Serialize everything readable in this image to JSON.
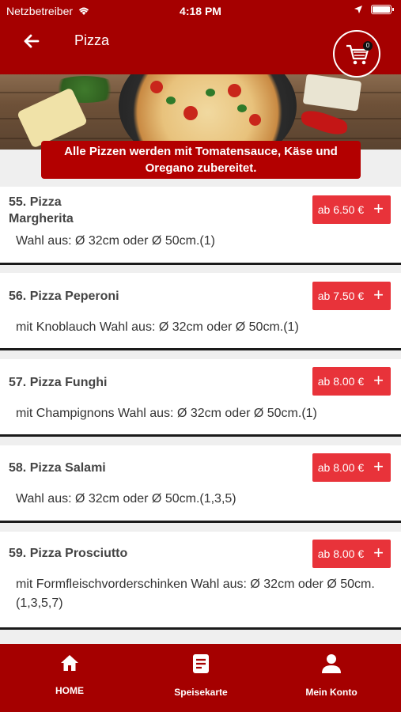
{
  "status_bar": {
    "carrier": "Netzbetreiber",
    "time": "4:18 PM"
  },
  "header": {
    "title": "Pizza",
    "cart_count": "0"
  },
  "banner": {
    "line1": "Alle Pizzen werden mit Tomatensauce, Käse und",
    "line2": "Oregano zubereitet."
  },
  "items": [
    {
      "name_line1": "55. Pizza",
      "name_line2": "Margherita",
      "price": "ab 6.50 €",
      "desc": "Wahl aus: Ø 32cm oder Ø 50cm.(1)"
    },
    {
      "name_line1": "56. Pizza Peperoni",
      "price": "ab 7.50 €",
      "desc": "mit Knoblauch Wahl aus: Ø 32cm oder Ø 50cm.(1)"
    },
    {
      "name_line1": "57. Pizza Funghi",
      "price": "ab 8.00 €",
      "desc": "mit Champignons Wahl aus: Ø 32cm oder Ø 50cm.(1)"
    },
    {
      "name_line1": "58. Pizza Salami",
      "price": "ab 8.00 €",
      "desc": "Wahl aus: Ø 32cm oder Ø 50cm.(1,3,5)"
    },
    {
      "name_line1": "59. Pizza Prosciutto",
      "price": "ab 8.00 €",
      "desc_line1": "mit Formfleischvorderschinken Wahl aus: Ø 32cm oder Ø 50cm.",
      "desc_line2": "(1,3,5,7)"
    }
  ],
  "bottom_nav": {
    "home": "HOME",
    "menu": "Speisekarte",
    "account": "Mein Konto"
  },
  "colors": {
    "primary": "#a50000",
    "price_button": "#e8333a"
  }
}
